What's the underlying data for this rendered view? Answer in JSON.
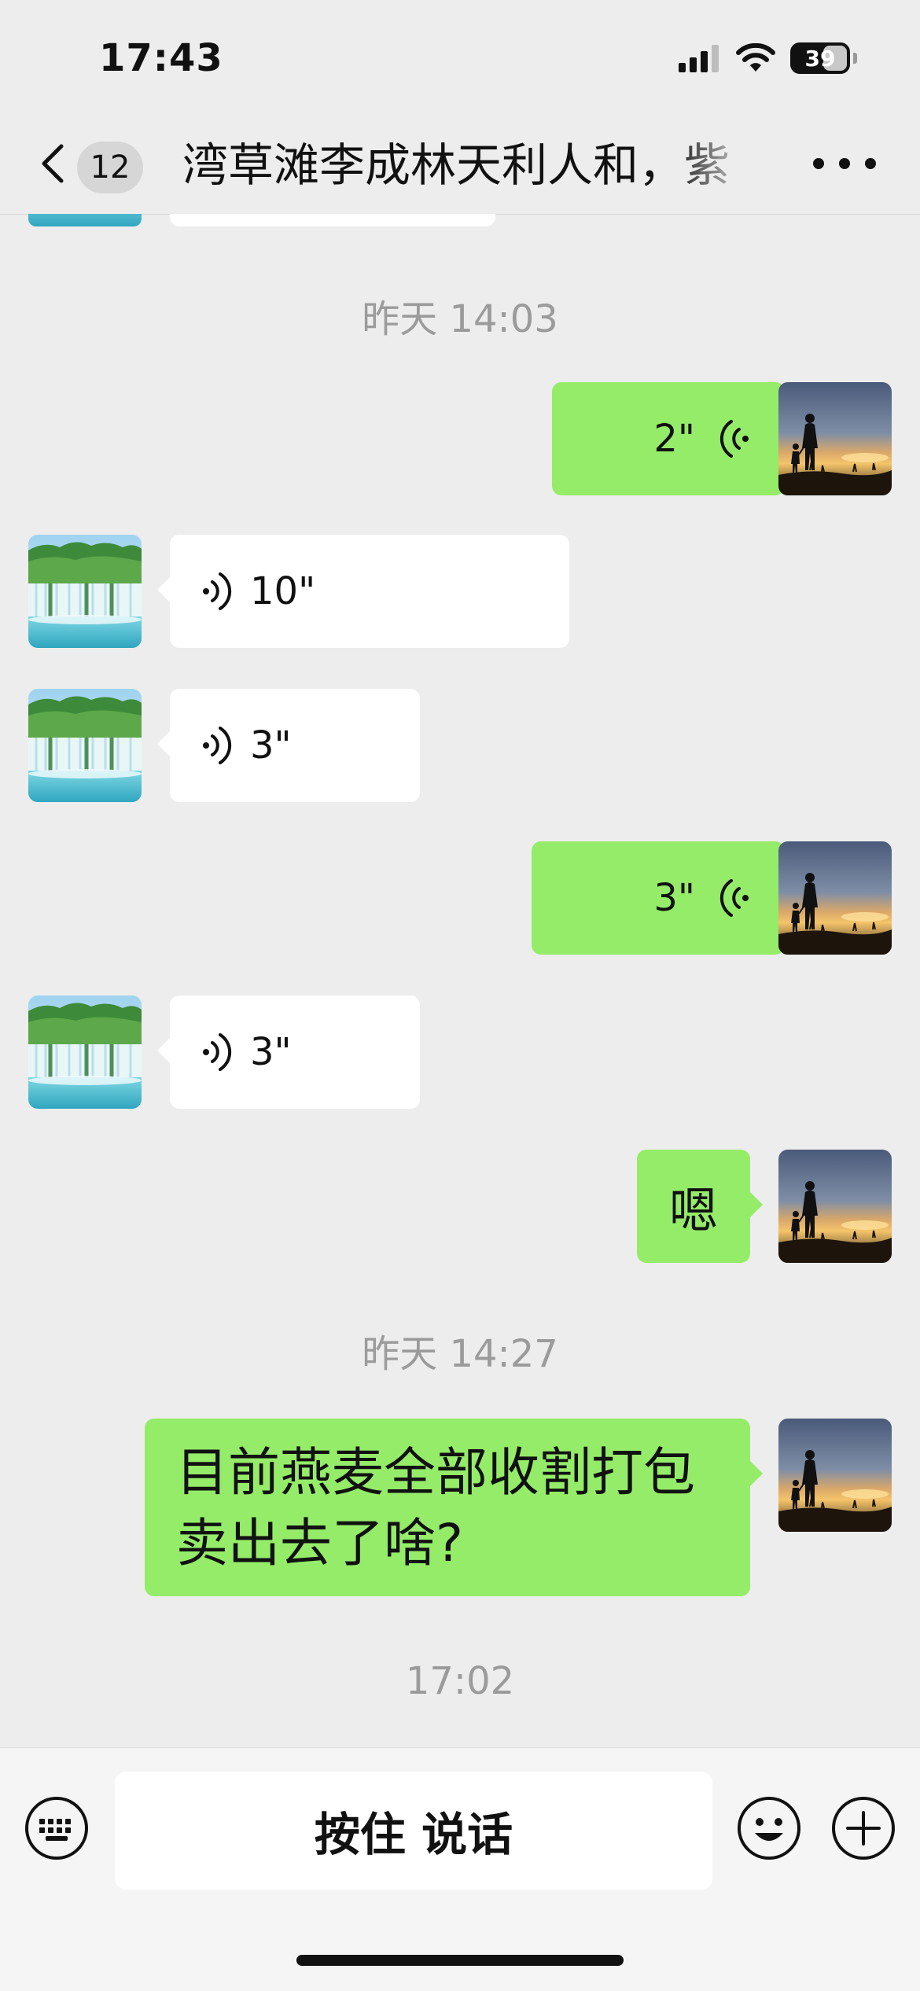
{
  "status_bar": {
    "time": "17:43",
    "battery": "39",
    "icons": [
      "cellular-signal-icon",
      "wifi-icon",
      "battery-icon"
    ]
  },
  "nav": {
    "unread_count": "12",
    "title": "湾草滩李成林天利人和，紫",
    "icons": [
      "chevron-left-icon",
      "more-icon"
    ]
  },
  "messages": [
    {
      "type": "timestamp",
      "text": "昨天 14:03"
    },
    {
      "type": "voice",
      "side": "right",
      "duration": "2\""
    },
    {
      "type": "voice",
      "side": "left",
      "duration": "10\""
    },
    {
      "type": "voice",
      "side": "left",
      "duration": "3\""
    },
    {
      "type": "voice",
      "side": "right",
      "duration": "3\""
    },
    {
      "type": "voice",
      "side": "left",
      "duration": "3\""
    },
    {
      "type": "text",
      "side": "right",
      "text": "嗯"
    },
    {
      "type": "timestamp",
      "text": "昨天 14:27"
    },
    {
      "type": "text",
      "side": "right",
      "lines": [
        "目前燕麦全部收割打包",
        "卖出去了啥?"
      ]
    },
    {
      "type": "timestamp",
      "text": "17:02"
    }
  ],
  "input_bar": {
    "hold_to_talk_label": "按住 说话",
    "icons": [
      "keyboard-icon",
      "emoji-icon",
      "plus-icon"
    ]
  },
  "colors": {
    "background": "#ededed",
    "sent_bubble": "#95ec69",
    "received_bubble": "#ffffff",
    "timestamp_text": "#9b9b9b"
  }
}
